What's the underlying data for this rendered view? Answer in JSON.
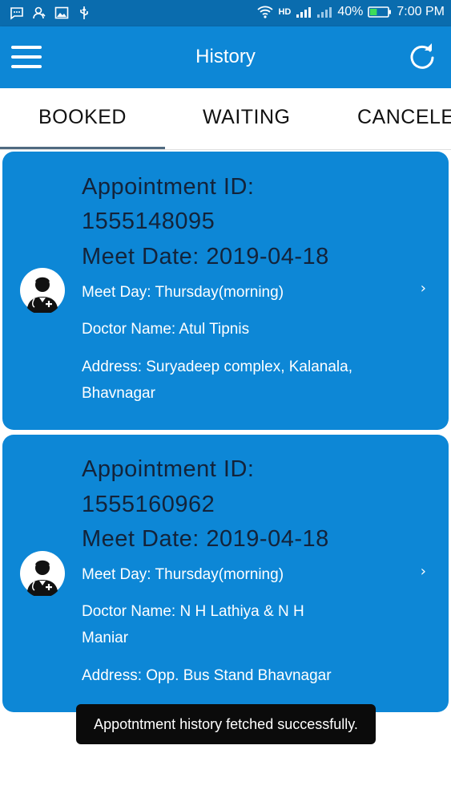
{
  "status_bar": {
    "battery_percent": "40%",
    "time": "7:00 PM",
    "network": "HD",
    "left_icons": [
      "message-icon",
      "contacts-icon",
      "image-icon",
      "usb-icon"
    ],
    "right_icons": [
      "wifi-icon",
      "signal-icon",
      "signal-weak-icon",
      "battery-icon"
    ],
    "battery_level": 0.4
  },
  "app_bar": {
    "title": "History",
    "menu_icon": "hamburger-menu-icon",
    "refresh_icon": "refresh-icon",
    "color": "#0d87d6"
  },
  "tabs": {
    "items": [
      {
        "label": "BOOKED",
        "selected": true
      },
      {
        "label": "WAITING",
        "selected": false
      },
      {
        "label": "CANCELE",
        "selected": false
      }
    ]
  },
  "appointments": [
    {
      "id_label": "Appointment ID:",
      "id_value": "1555148095",
      "meet_date": "Meet Date: 2019-04-18",
      "meet_day": "Meet Day: Thursday(morning)",
      "doctor_line1": "Doctor Name: Atul Tipnis",
      "doctor_line2": "",
      "address_line1": "Address: Suryadeep complex, Kalanala,",
      "address_line2": "Bhavnagar",
      "chevron": "›"
    },
    {
      "id_label": "Appointment ID:",
      "id_value": "1555160962",
      "meet_date": "Meet Date: 2019-04-18",
      "meet_day": "Meet Day: Thursday(morning)",
      "doctor_line1": "Doctor Name: N H Lathiya & N H",
      "doctor_line2": "Maniar",
      "address_line1": "Address: Opp. Bus Stand Bhavnagar",
      "address_line2": "",
      "chevron": "›"
    }
  ],
  "toast": {
    "message": "Appotntment history fetched successfully."
  },
  "colors": {
    "status_bar": "#0a6cae",
    "card": "#0d87d6",
    "card_heading_text": "#13233a",
    "tab_indicator": "#4f6a80",
    "battery_fill": "#3ddc5a"
  }
}
